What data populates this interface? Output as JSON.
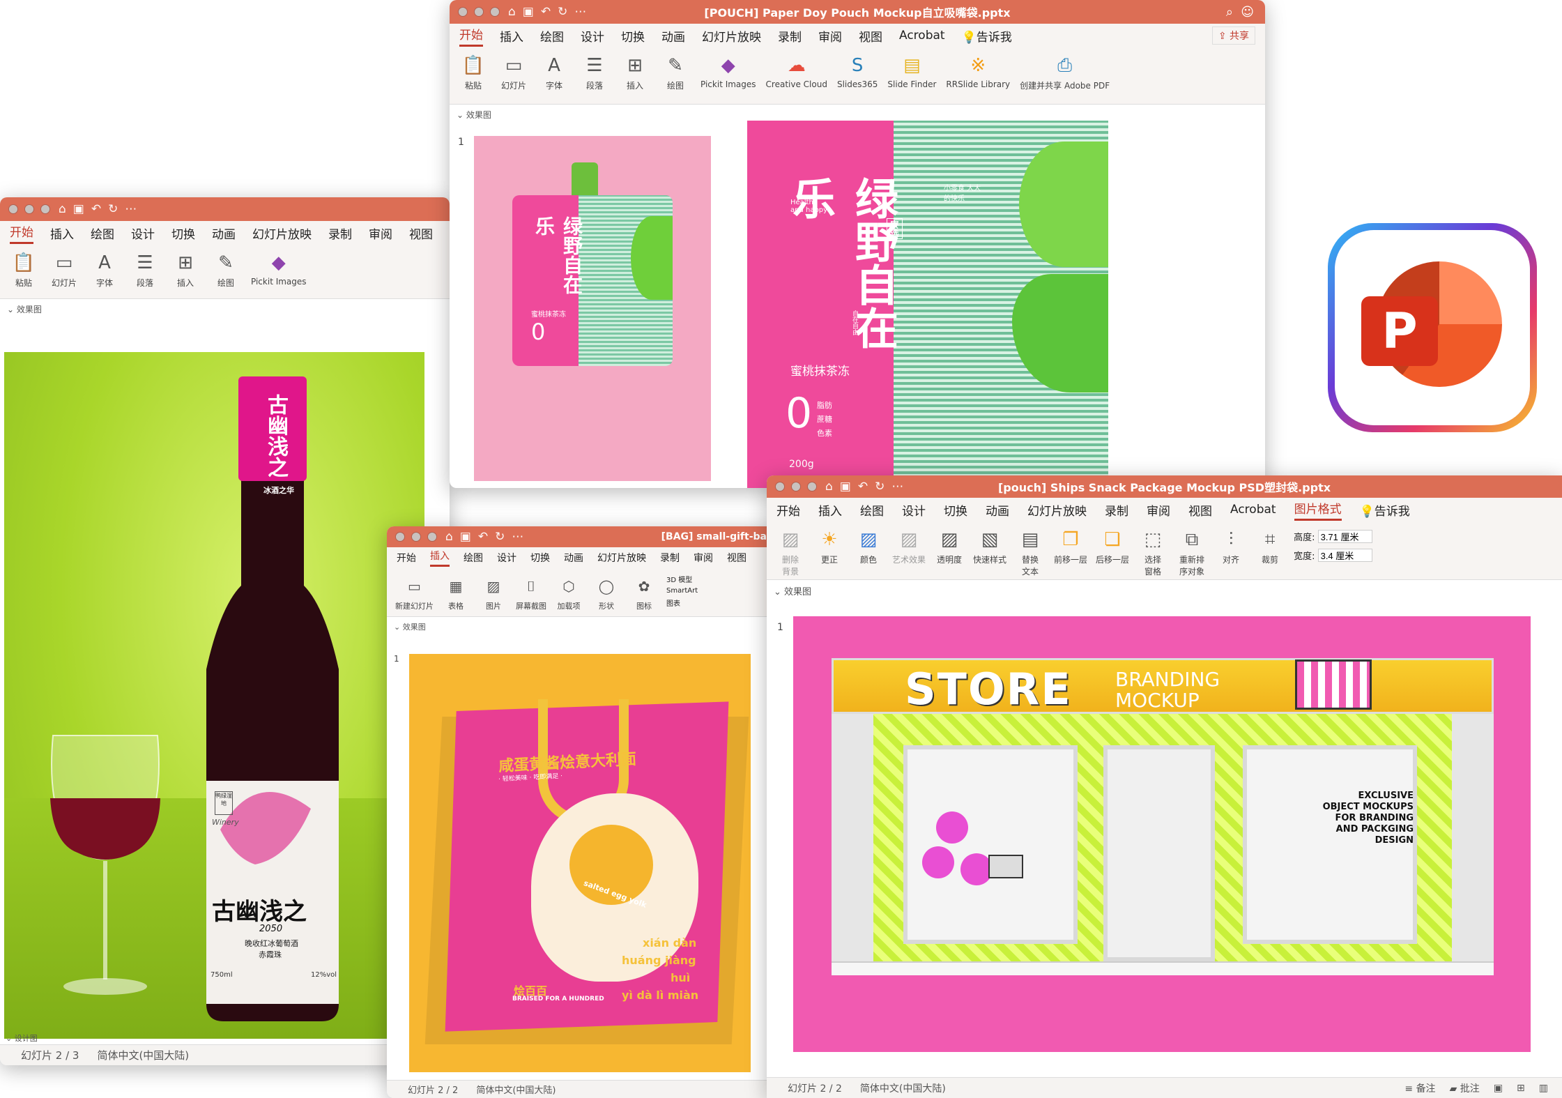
{
  "win_wine": {
    "tabs": [
      "开始",
      "插入",
      "绘图",
      "设计",
      "切换",
      "动画",
      "幻灯片放映",
      "录制",
      "审阅",
      "视图"
    ],
    "ribbon": [
      "粘贴",
      "幻灯片",
      "字体",
      "段落",
      "插入",
      "绘图",
      "Pickit Images"
    ],
    "section": "效果图",
    "section2": "设计图",
    "status_slide": "幻灯片 2 / 3",
    "status_lang": "简体中文(中国大陆)",
    "bottle_label_top": "古幽浅之",
    "bottle_label_neck": "冰酒之华",
    "bottle_brand": "古幽浅之",
    "bottle_year": "2050",
    "bottle_sub1": "晚收红冰葡萄酒",
    "bottle_sub2": "赤霞珠",
    "bottle_vol": "750ml",
    "bottle_abv": "12%vol",
    "bottle_seal": "鸭绿湿地",
    "bottle_script": "Winery"
  },
  "win_pouch": {
    "title": "[POUCH] Paper Doy Pouch Mockup自立吸嘴袋.pptx",
    "tabs": [
      "开始",
      "插入",
      "绘图",
      "设计",
      "切换",
      "动画",
      "幻灯片放映",
      "录制",
      "审阅",
      "视图",
      "Acrobat",
      "告诉我"
    ],
    "share": "共享",
    "ribbon": [
      "粘贴",
      "幻灯片",
      "字体",
      "段落",
      "插入",
      "绘图",
      "Pickit Images",
      "Creative Cloud",
      "Slides365",
      "Slide Finder",
      "RRSlide Library",
      "创建并共享 Adobe PDF"
    ],
    "section": "效果图",
    "slide_no": "1",
    "brand_big": "绿野自在乐",
    "brand_en": "Healthy and happy",
    "tag_right": "小零食 大大的快乐",
    "tag_box": "寮选",
    "small_v": "自在自由",
    "flavor": "蜜桃抹茶冻",
    "zero": "0",
    "zero_items": [
      "脂肪",
      "蔗糖",
      "色素"
    ],
    "weight": "200g"
  },
  "win_bag": {
    "title": "[BAG] small-gift-bag",
    "tabs": [
      "开始",
      "插入",
      "绘图",
      "设计",
      "切换",
      "动画",
      "幻灯片放映",
      "录制",
      "审阅",
      "视图"
    ],
    "ribbon": [
      "新建幻灯片",
      "表格",
      "图片",
      "屏幕截图",
      "加载项",
      "形状",
      "图标"
    ],
    "ribbon_small": [
      "3D 模型",
      "SmartArt",
      "图表"
    ],
    "section": "效果图",
    "slide_no": "1",
    "status_slide": "幻灯片 2 / 2",
    "status_lang": "简体中文(中国大陆)",
    "headline": "咸蛋黄酱烩意大利面",
    "sub": "· 轻松美味 · 吃即满足 ·",
    "egg_text": "salted egg yolk",
    "pinyin": [
      "xián dàn",
      "huáng jiàng",
      "huì",
      "yì dà lì miàn"
    ],
    "brand": "烩百百",
    "brand_en": "BRAISED FOR A HUNDRED"
  },
  "win_store": {
    "title": "[pouch] Ships Snack Package Mockup PSD塑封袋.pptx",
    "tabs": [
      "开始",
      "插入",
      "绘图",
      "设计",
      "切换",
      "动画",
      "幻灯片放映",
      "录制",
      "审阅",
      "视图",
      "Acrobat",
      "图片格式",
      "告诉我"
    ],
    "ribbon": [
      "删除背景",
      "更正",
      "颜色",
      "艺术效果",
      "透明度",
      "快速样式",
      "替换文本",
      "前移一层",
      "后移一层",
      "选择窗格",
      "重新排序对象",
      "对齐",
      "裁剪"
    ],
    "height_label": "高度:",
    "height_val": "3.71 厘米",
    "width_label": "宽度:",
    "width_val": "3.4 厘米",
    "section": "效果图",
    "slide_no": "1",
    "sign_big": "STORE",
    "sign_small1": "BRANDING",
    "sign_small2": "MOCKUP",
    "window_text": [
      "EXCLUSIVE",
      "OBJECT MOCKUPS",
      "FOR BRANDING",
      "AND PACKGING",
      "DESIGN"
    ],
    "status_slide": "幻灯片 2 / 2",
    "status_lang": "简体中文(中国大陆)",
    "notes": "备注",
    "comments": "批注"
  },
  "app_icon": {
    "letter": "P"
  },
  "colors": {
    "titlebar": "#dc6e55",
    "pink": "#ef4a9b",
    "lime": "#b8e03a",
    "yellow": "#f7b731"
  }
}
